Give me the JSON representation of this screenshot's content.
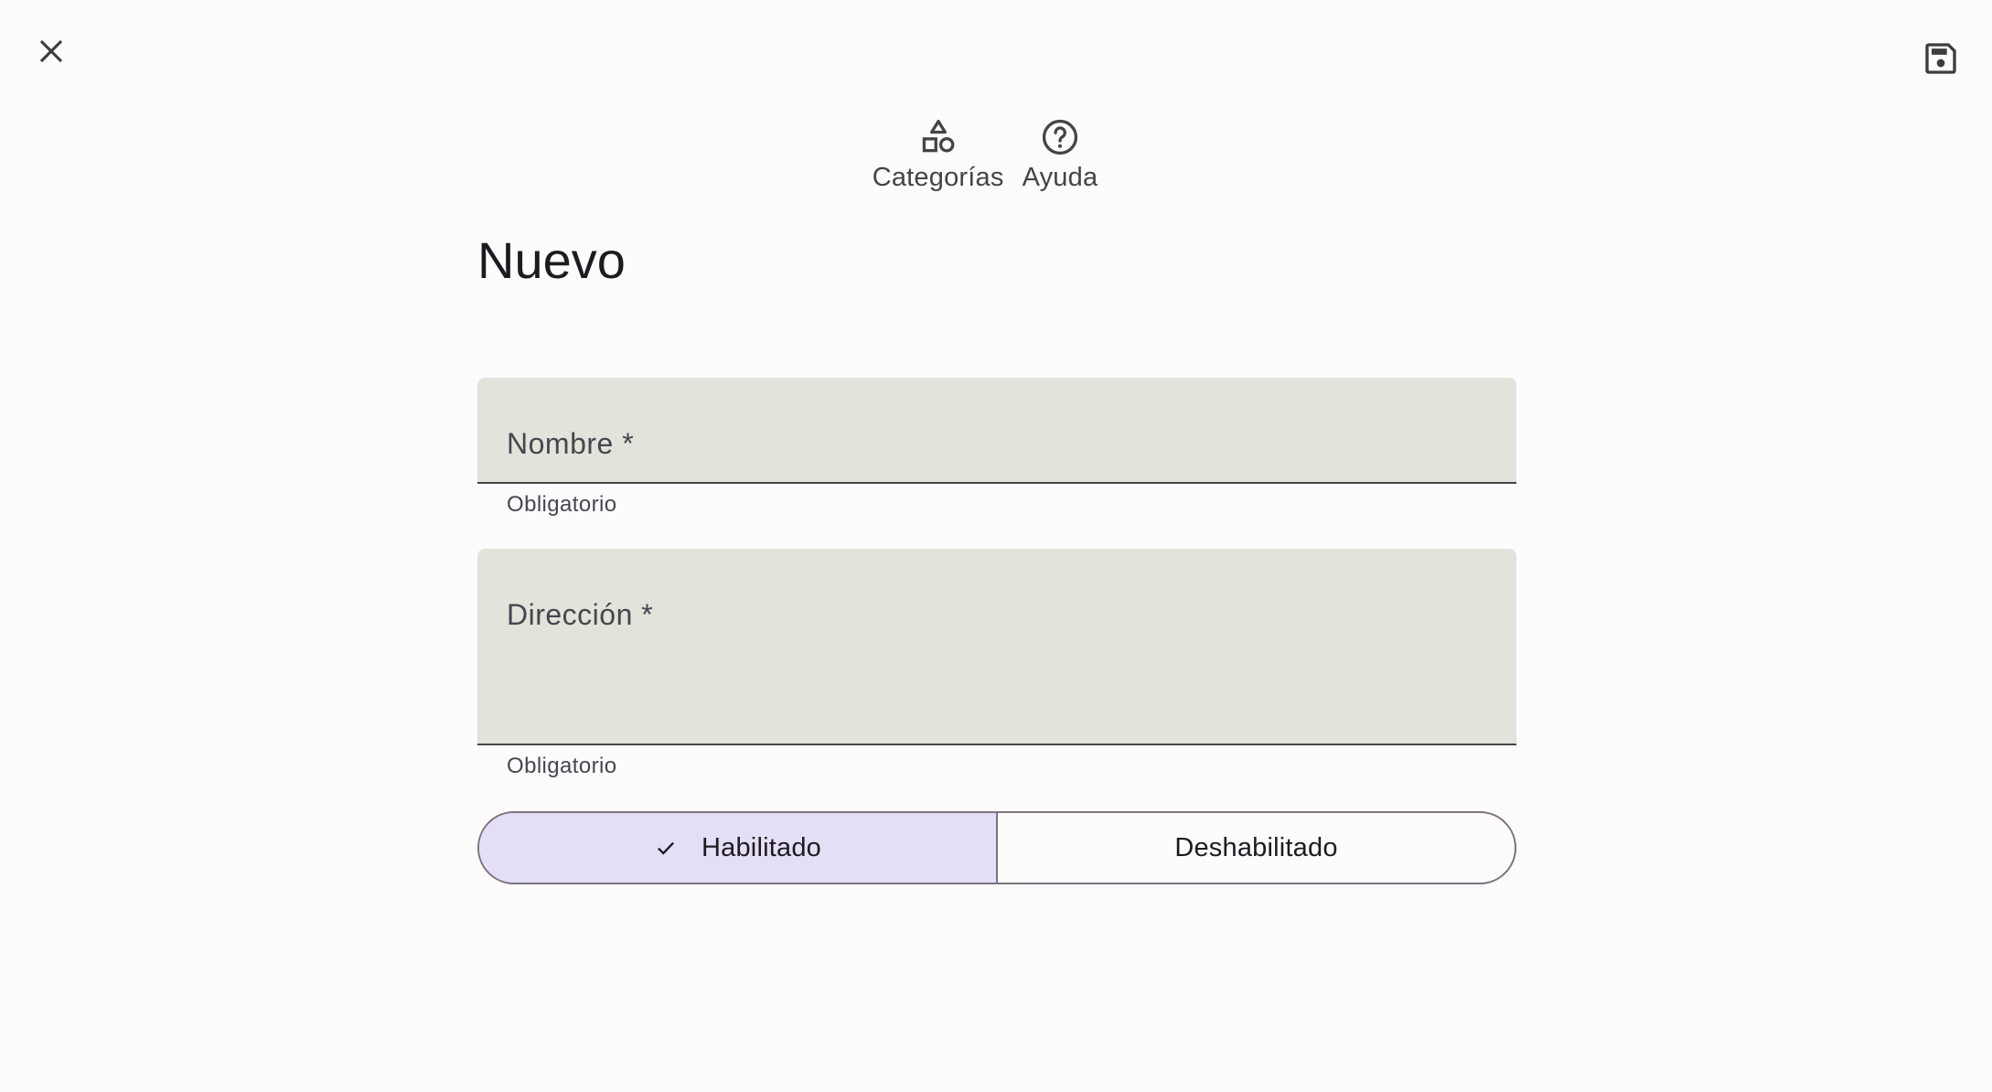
{
  "header": {
    "close_icon": "close-icon",
    "save_icon": "save-icon"
  },
  "actions": [
    {
      "label": "Categorías",
      "icon": "categories-icon"
    },
    {
      "label": "Ayuda",
      "icon": "help-icon"
    }
  ],
  "page": {
    "title": "Nuevo"
  },
  "form": {
    "nombre": {
      "label": "Nombre *",
      "value": "",
      "helper": "Obligatorio"
    },
    "direccion": {
      "label": "Dirección *",
      "value": "",
      "helper": "Obligatorio"
    }
  },
  "status_toggle": {
    "options": [
      {
        "label": "Habilitado",
        "selected": true
      },
      {
        "label": "Deshabilitado",
        "selected": false
      }
    ]
  },
  "colors": {
    "background": "#fefbfd",
    "field_fill": "#e0e4da",
    "selected_segment": "#e5def7"
  }
}
